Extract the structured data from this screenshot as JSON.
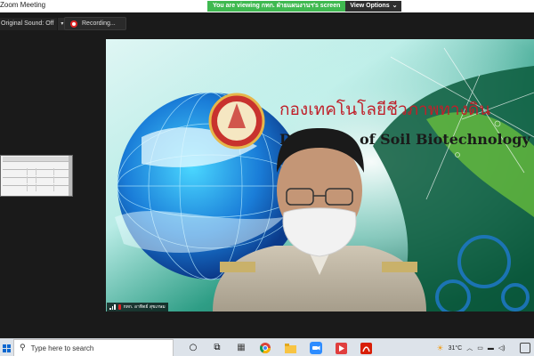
{
  "window": {
    "title": "Zoom Meeting"
  },
  "share_banner": {
    "message": "You are viewing กทก. ฝ่ายแผนงานฯ's screen",
    "view_options": "View Options",
    "colors": {
      "banner": "#3fb950",
      "options": "#2f2f2f"
    }
  },
  "toolbar": {
    "original_sound": "Original Sound: Off",
    "recording": "Recording..."
  },
  "video": {
    "thai_title": "กองเทคโนโลยีชีวภาพทางดิน",
    "english_title_visible": "Di       of Soil Biotechnology",
    "participant_name": "กทก. อาทิตย์ สุขเกษม"
  },
  "taskbar": {
    "search_placeholder": "Type here to search",
    "icons": [
      "windows-icon",
      "search-icon",
      "task-view-icon",
      "widgets-icon",
      "chrome-icon",
      "file-explorer-icon",
      "zoom-icon",
      "video-app-icon",
      "pdf-icon"
    ],
    "weather": "31°C"
  }
}
